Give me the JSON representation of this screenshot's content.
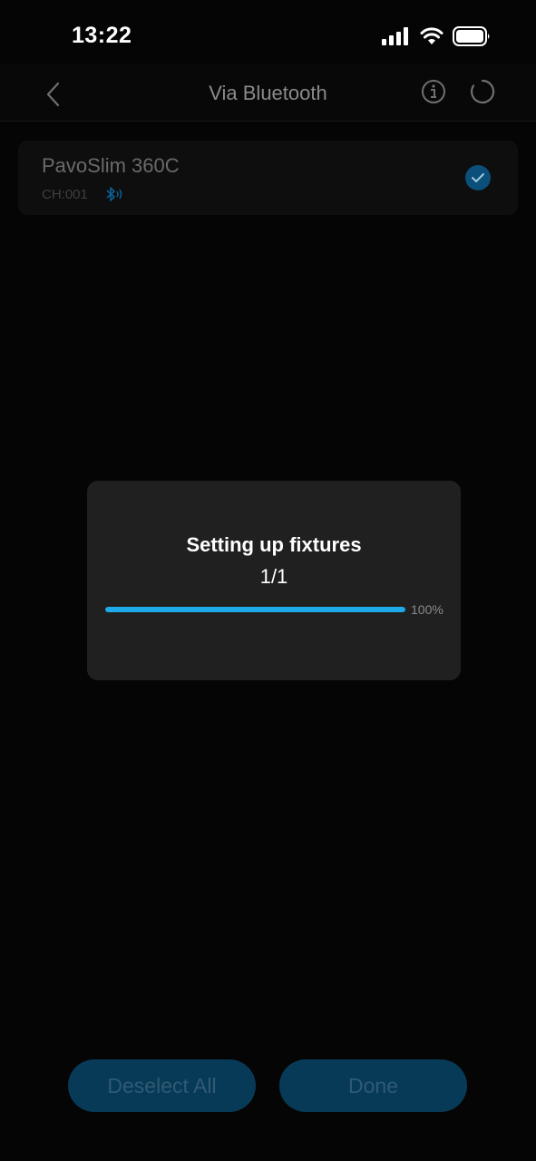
{
  "status_bar": {
    "time": "13:22"
  },
  "nav": {
    "title": "Via Bluetooth"
  },
  "device": {
    "name": "PavoSlim 360C",
    "channel": "CH:001",
    "selected": true
  },
  "dialog": {
    "title": "Setting up fixtures",
    "count": "1/1",
    "progress_label": "100%",
    "progress": 1.0
  },
  "buttons": {
    "deselect_all": "Deselect All",
    "done": "Done"
  },
  "colors": {
    "accent": "#1ea9e8",
    "button_bg": "#073a57",
    "dialog_bg": "#202020"
  },
  "icons": [
    "back-chevron-icon",
    "info-icon",
    "refresh-icon",
    "bluetooth-icon",
    "checkmark-icon",
    "cellular-signal-icon",
    "wifi-icon",
    "battery-icon"
  ]
}
